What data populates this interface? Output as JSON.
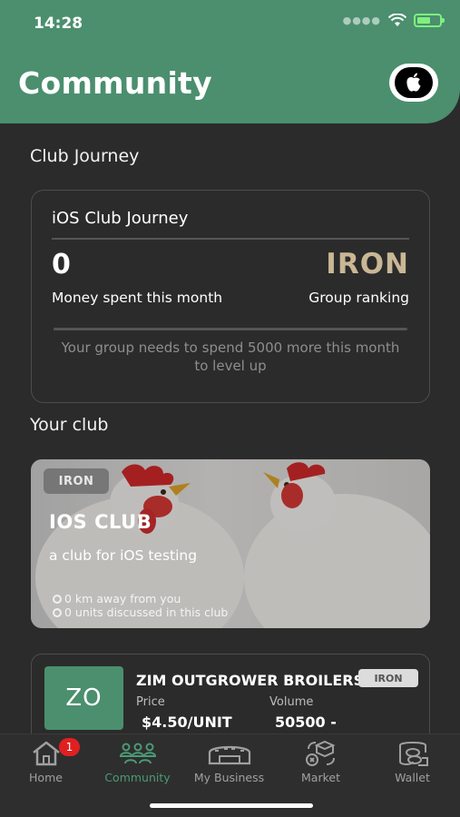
{
  "status_bar": {
    "time": "14:28"
  },
  "header": {
    "title": "Community",
    "apple_button_icon": "apple-icon"
  },
  "club_journey": {
    "section_title": "Club Journey",
    "card_title": "iOS Club Journey",
    "amount": "0",
    "amount_label": "Money spent this month",
    "rank": "IRON",
    "rank_label": "Group ranking",
    "message": "Your group needs to spend 5000 more this month to level up"
  },
  "your_club": {
    "section_title": "Your club",
    "badge": "IRON",
    "name": "IOS CLUB",
    "description": "a club for iOS testing",
    "distance": "0 km away from you",
    "units": "0 units discussed in this club"
  },
  "listing": {
    "thumb_text": "ZO",
    "title": "ZIM OUTGROWER BROILERS DEC",
    "badge": "IRON",
    "price_label": "Price",
    "price_value": "$4.50/UNIT",
    "volume_label": "Volume",
    "volume_value": "50500 -"
  },
  "tabbar": {
    "items": [
      {
        "label": "Home",
        "icon": "home-icon",
        "badge": "1"
      },
      {
        "label": "Community",
        "icon": "community-icon"
      },
      {
        "label": "My Business",
        "icon": "barn-icon"
      },
      {
        "label": "Market",
        "icon": "market-icon"
      },
      {
        "label": "Wallet",
        "icon": "wallet-icon"
      }
    ],
    "active_index": 1
  },
  "colors": {
    "accent_green": "#4b8f6e",
    "background": "#2b2b2b",
    "iron_gold": "#c9b795",
    "badge_red": "#e02020"
  }
}
